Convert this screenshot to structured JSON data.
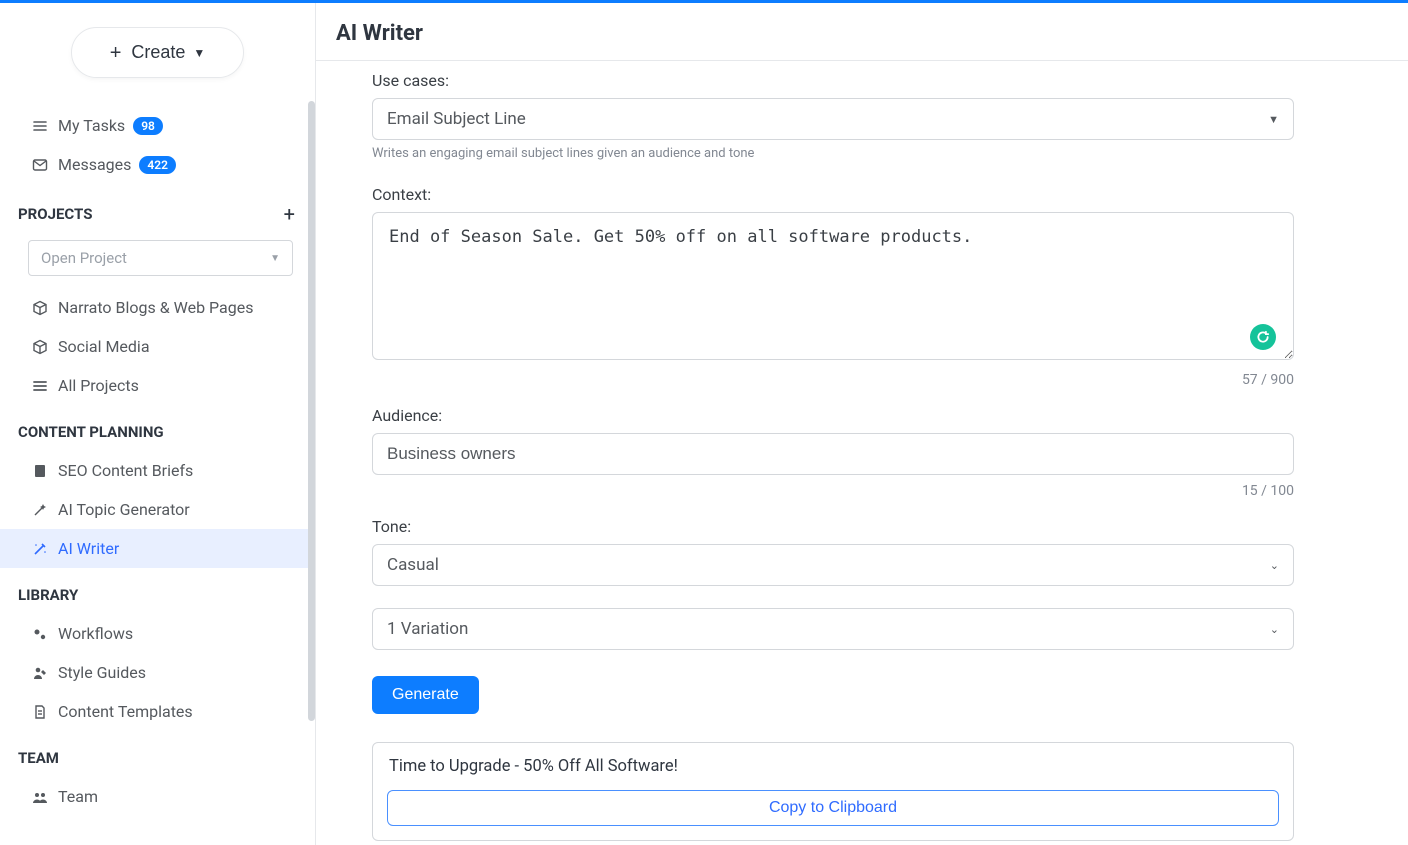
{
  "sidebar": {
    "create_label": "Create",
    "my_tasks_label": "My Tasks",
    "my_tasks_badge": "98",
    "messages_label": "Messages",
    "messages_badge": "422",
    "projects_title": "PROJECTS",
    "open_project_placeholder": "Open Project",
    "project_items": [
      {
        "label": "Narrato Blogs & Web Pages"
      },
      {
        "label": "Social Media"
      },
      {
        "label": "All Projects"
      }
    ],
    "content_planning_title": "CONTENT PLANNING",
    "content_planning_items": [
      {
        "label": "SEO Content Briefs"
      },
      {
        "label": "AI Topic Generator"
      },
      {
        "label": "AI Writer"
      }
    ],
    "library_title": "LIBRARY",
    "library_items": [
      {
        "label": "Workflows"
      },
      {
        "label": "Style Guides"
      },
      {
        "label": "Content Templates"
      }
    ],
    "team_title": "TEAM",
    "team_label": "Team"
  },
  "header": {
    "title": "AI Writer"
  },
  "form": {
    "usecases_label": "Use cases:",
    "usecases_value": "Email Subject Line",
    "usecases_hint": "Writes an engaging email subject lines given an audience and tone",
    "context_label": "Context:",
    "context_value": "End of Season Sale. Get 50% off on all software products.",
    "context_counter": "57 / 900",
    "audience_label": "Audience:",
    "audience_value": "Business owners",
    "audience_counter": "15 / 100",
    "tone_label": "Tone:",
    "tone_value": "Casual",
    "variation_value": "1 Variation",
    "generate_label": "Generate",
    "result_text": "Time to Upgrade - 50% Off All Software!",
    "copy_label": "Copy to Clipboard"
  }
}
